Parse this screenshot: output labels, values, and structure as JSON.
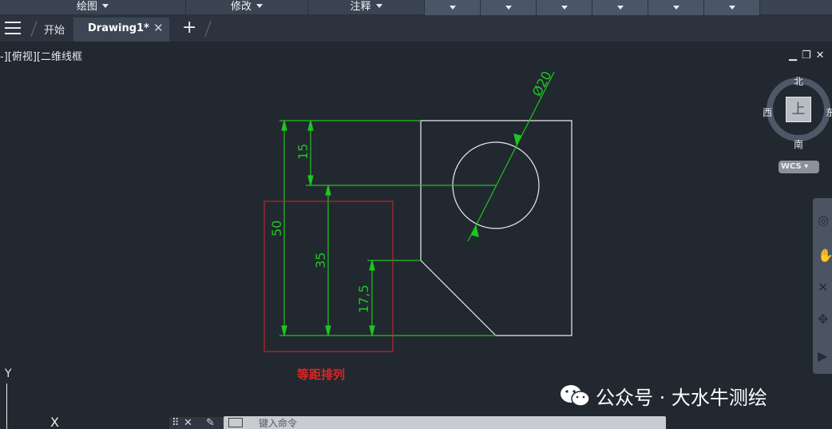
{
  "ribbon": {
    "panels": [
      "绘图",
      "修改",
      "注释"
    ]
  },
  "tabs": {
    "start_label": "开始",
    "drawing_label": "Drawing1*",
    "close_glyph": "✕",
    "new_tab_glyph": "+"
  },
  "viewport": {
    "view_label": "-][俯视][二维线框"
  },
  "viewcube": {
    "north": "北",
    "south": "南",
    "west": "西",
    "east": "东",
    "face": "上",
    "wcs": "WCS"
  },
  "drawing": {
    "dims": {
      "diameter": "Ø20",
      "d15": "15",
      "d50": "50",
      "d35": "35",
      "d17_5": "17,5"
    },
    "annotation": "等距排列",
    "colors": {
      "dimension": "#1ec51e",
      "geometry": "#e9ecef",
      "annotation": "#e02525"
    }
  },
  "ucs": {
    "y": "Y",
    "x": "X"
  },
  "command": {
    "placeholder": "键入命令"
  },
  "watermark": {
    "text": "公众号 · 大水牛测绘"
  }
}
